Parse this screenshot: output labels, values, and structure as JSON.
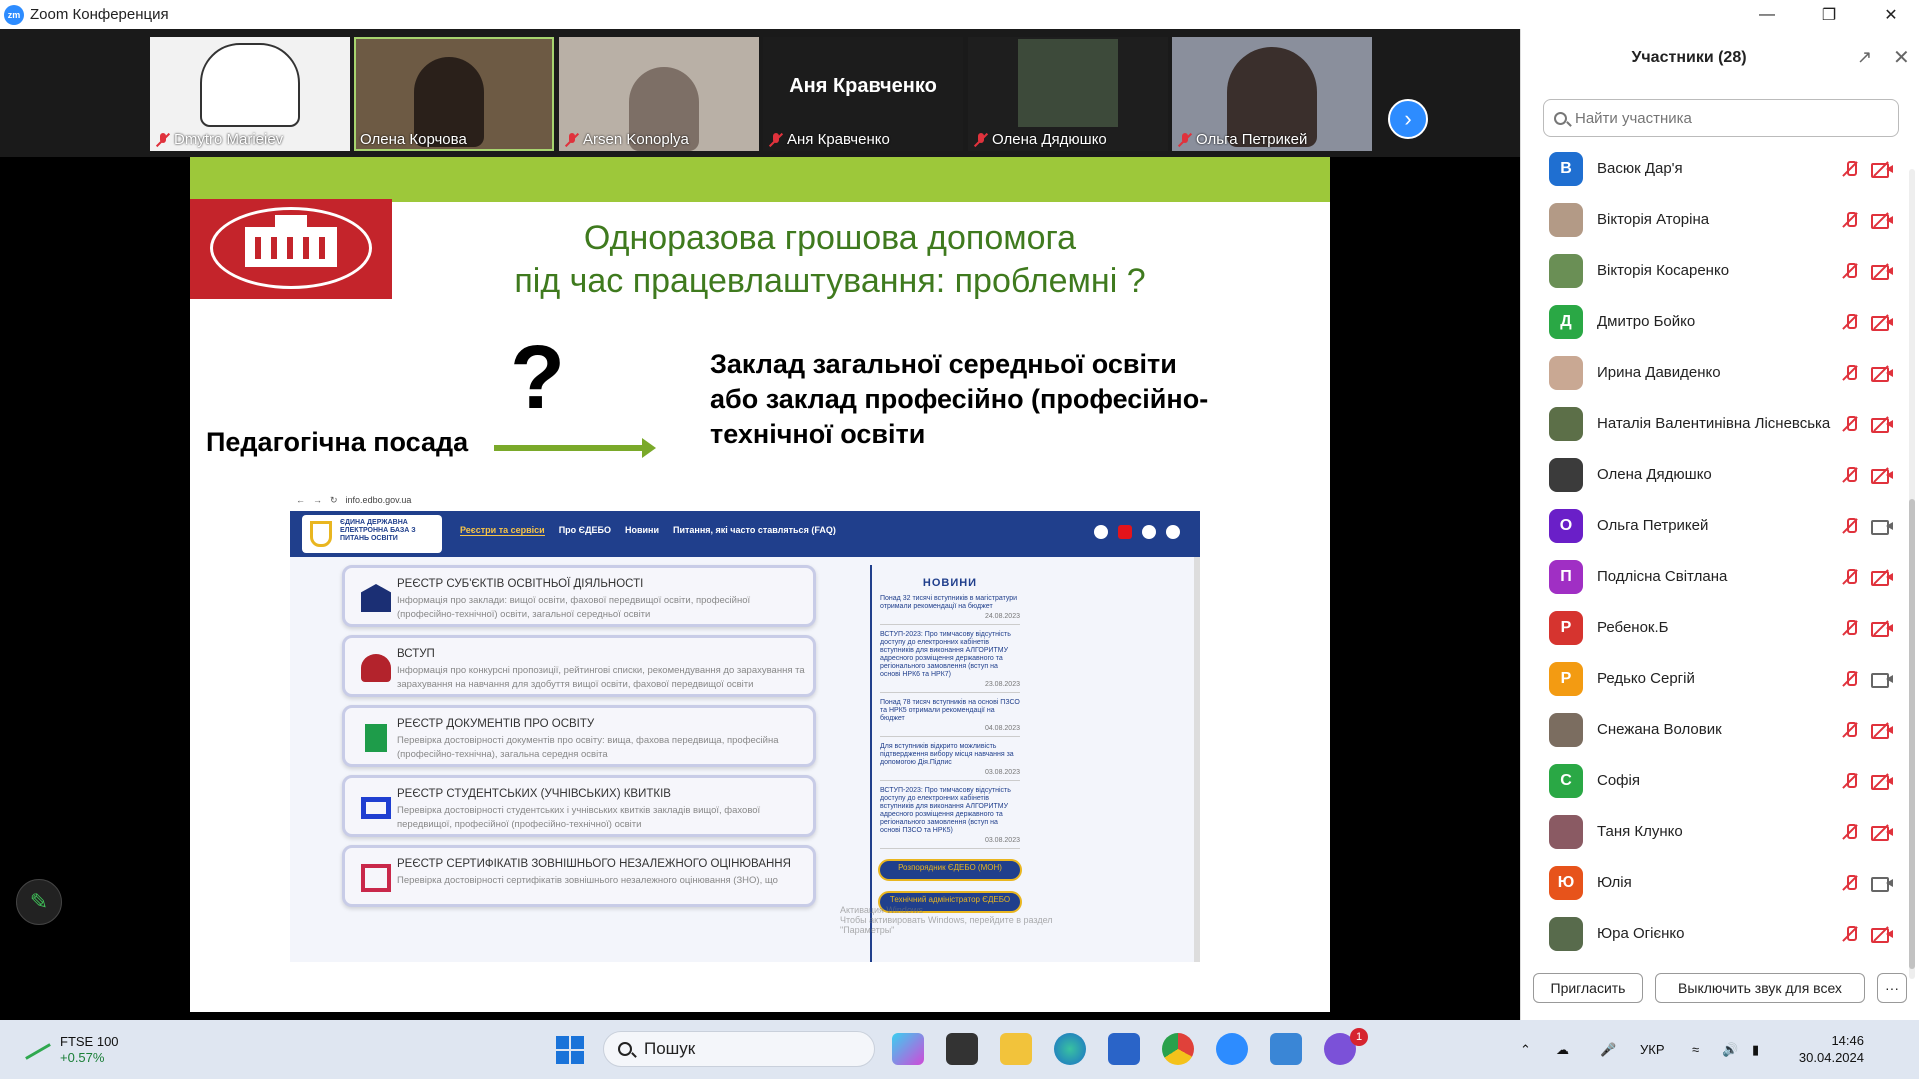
{
  "window": {
    "title": "Zoom Конференция",
    "logo": "zm"
  },
  "strip": {
    "tiles": [
      {
        "name": "Dmytro Marieiev"
      },
      {
        "name": "Олена Корчова"
      },
      {
        "name": "Arsen Konoplya"
      },
      {
        "name": "Аня Кравченко",
        "bigname": "Аня Кравченко"
      },
      {
        "name": "Олена Дядюшко"
      },
      {
        "name": "Ольга Петрикей"
      }
    ]
  },
  "slide": {
    "title_line1": "Одноразова грошова допомога",
    "title_line2": "під час працевлаштування: проблемні ?",
    "question": "?",
    "ped": "Педагогічна посада",
    "zaklad_line1": "Заклад загальної середньої освіти",
    "zaklad_line2": "або заклад професійно (професійно-",
    "zaklad_line3": "технічної освіти"
  },
  "browser": {
    "url": "info.edbo.gov.ua",
    "logo_text": "ЄДИНА ДЕРЖАВНА ЕЛЕКТРОННА БАЗА З ПИТАНЬ ОСВІТИ",
    "menu": [
      "Реєстри та сервіси",
      "Про ЄДЕБО",
      "Новини",
      "Питання, які часто ставляться (FAQ)"
    ],
    "cards": [
      {
        "title": "РЕЄСТР СУБ'ЄКТІВ ОСВІТНЬОЇ ДІЯЛЬНОСТІ",
        "desc": "Інформація про заклади: вищої освіти, фахової передвищої освіти, професійної (професійно-технічної) освіти, загальної середньої освіти"
      },
      {
        "title": "ВСТУП",
        "desc": "Інформація про конкурсні пропозиції, рейтингові списки, рекомендування до зарахування та зарахування на навчання для здобуття вищої освіти, фахової передвищої освіти"
      },
      {
        "title": "РЕЄСТР ДОКУМЕНТІВ ПРО ОСВІТУ",
        "desc": "Перевірка достовірності документів про освіту: вища, фахова передвища, професійна (професійно-технічна), загальна середня освіта"
      },
      {
        "title": "РЕЄСТР СТУДЕНТСЬКИХ (УЧНІВСЬКИХ) КВИТКІВ",
        "desc": "Перевірка достовірності студентських і учнівських квитків закладів вищої, фахової передвищої, професійної (професійно-технічної) освіти"
      },
      {
        "title": "РЕЄСТР СЕРТИФІКАТІВ ЗОВНІШНЬОГО НЕЗАЛЕЖНОГО ОЦІНЮВАННЯ",
        "desc": "Перевірка достовірності сертифікатів зовнішнього незалежного оцінювання (ЗНО), що"
      }
    ],
    "news_heading": "НОВИНИ",
    "news": [
      {
        "text": "Понад 32 тисячі вступників в магістратури отримали рекомендації на бюджет",
        "date": "24.08.2023"
      },
      {
        "text": "ВСТУП-2023: Про тимчасову відсутність доступу до електронних кабінетів вступників для виконання АЛГОРИТМУ адресного розміщення державного та регіонального замовлення (вступ на основі НРК6 та НРК7)",
        "date": "23.08.2023"
      },
      {
        "text": "Понад 78 тисяч вступників на основі ПЗСО та НРК5 отримали рекомендації на бюджет",
        "date": "04.08.2023"
      },
      {
        "text": "Для вступників відкрито можливість підтвердження вибору місця навчання за допомогою Дія.Підпис",
        "date": "03.08.2023"
      },
      {
        "text": "ВСТУП-2023: Про тимчасову відсутність доступу до електронних кабінетів вступників для виконання АЛГОРИТМУ адресного розміщення державного та регіонального замовлення (вступ на основі ПЗСО та НРК5)",
        "date": "03.08.2023"
      }
    ],
    "btn1": "Розпорядник ЄДЕБО (МОН)",
    "btn2": "Технічний адміністратор ЄДЕБО",
    "watermark1": "Активация Windows",
    "watermark2": "Чтобы активировать Windows, перейдите в раздел",
    "watermark3": "\"Параметры\""
  },
  "panel": {
    "title": "Участники (28)",
    "search_placeholder": "Найти участника",
    "participants": [
      {
        "name": "Васюк Дар'я",
        "initial": "В",
        "color": "#1f6fd1",
        "cam": "off"
      },
      {
        "name": "Вікторія Аторіна",
        "initial": "",
        "color": "#b39a86",
        "cam": "off"
      },
      {
        "name": "Вікторія Косаренко",
        "initial": "",
        "color": "#6a8f55",
        "cam": "off"
      },
      {
        "name": "Дмитро Бойко",
        "initial": "Д",
        "color": "#2aa845",
        "cam": "off"
      },
      {
        "name": "Ирина Давиденко",
        "initial": "",
        "color": "#c9a893",
        "cam": "off"
      },
      {
        "name": "Наталія Валентинівна Лісневська",
        "initial": "",
        "color": "#5c6f48",
        "cam": "off"
      },
      {
        "name": "Олена Дядюшко",
        "initial": "",
        "color": "#3b3b3b",
        "cam": "off"
      },
      {
        "name": "Ольга Петрикей",
        "initial": "О",
        "color": "#6a1fc8",
        "cam": "on"
      },
      {
        "name": "Подлісна Світлана",
        "initial": "П",
        "color": "#a02fc4",
        "cam": "off"
      },
      {
        "name": "Ребенок.Б",
        "initial": "Р",
        "color": "#d6342f",
        "cam": "off"
      },
      {
        "name": "Редько Сергій",
        "initial": "Р",
        "color": "#f39b12",
        "cam": "on"
      },
      {
        "name": "Снежана Воловик",
        "initial": "",
        "color": "#7b6d60",
        "cam": "off"
      },
      {
        "name": "Софія",
        "initial": "С",
        "color": "#2aa845",
        "cam": "off"
      },
      {
        "name": "Таня Клунко",
        "initial": "",
        "color": "#8a5a63",
        "cam": "off"
      },
      {
        "name": "Юлія",
        "initial": "Ю",
        "color": "#e7531b",
        "cam": "on"
      },
      {
        "name": "Юра Огієнко",
        "initial": "",
        "color": "#586b4c",
        "cam": "off"
      }
    ],
    "invite_label": "Пригласить",
    "mute_all_label": "Выключить звук для всех",
    "more_label": "···"
  },
  "taskbar": {
    "stock_name": "FTSE 100",
    "stock_change": "+0.57%",
    "search_label": "Пошук",
    "lang": "УКР",
    "time": "14:46",
    "date": "30.04.2024",
    "badge": "1"
  }
}
